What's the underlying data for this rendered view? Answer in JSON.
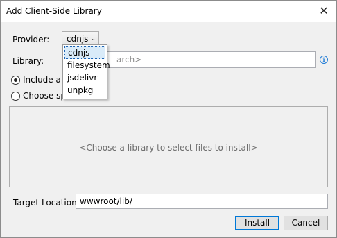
{
  "window": {
    "title": "Add Client-Side Library"
  },
  "provider": {
    "label": "Provider:",
    "value": "cdnjs",
    "options": [
      "cdnjs",
      "filesystem",
      "jsdelivr",
      "unpkg"
    ]
  },
  "library": {
    "label": "Library:",
    "placeholder": "arch>"
  },
  "files": {
    "include_all_label": "Include all",
    "choose_specific_label": "Choose sp",
    "panel_placeholder": "<Choose a library to select files to install>"
  },
  "target": {
    "label": "Target Location:",
    "value": "wwwroot/lib/"
  },
  "buttons": {
    "install": "Install",
    "cancel": "Cancel"
  },
  "icons": {
    "close": "close-icon",
    "info": "info-icon",
    "chevron": "chevron-down-icon"
  },
  "colors": {
    "accent": "#0078d7",
    "selection": "#d9ebf9",
    "info": "#1e7bd6"
  }
}
